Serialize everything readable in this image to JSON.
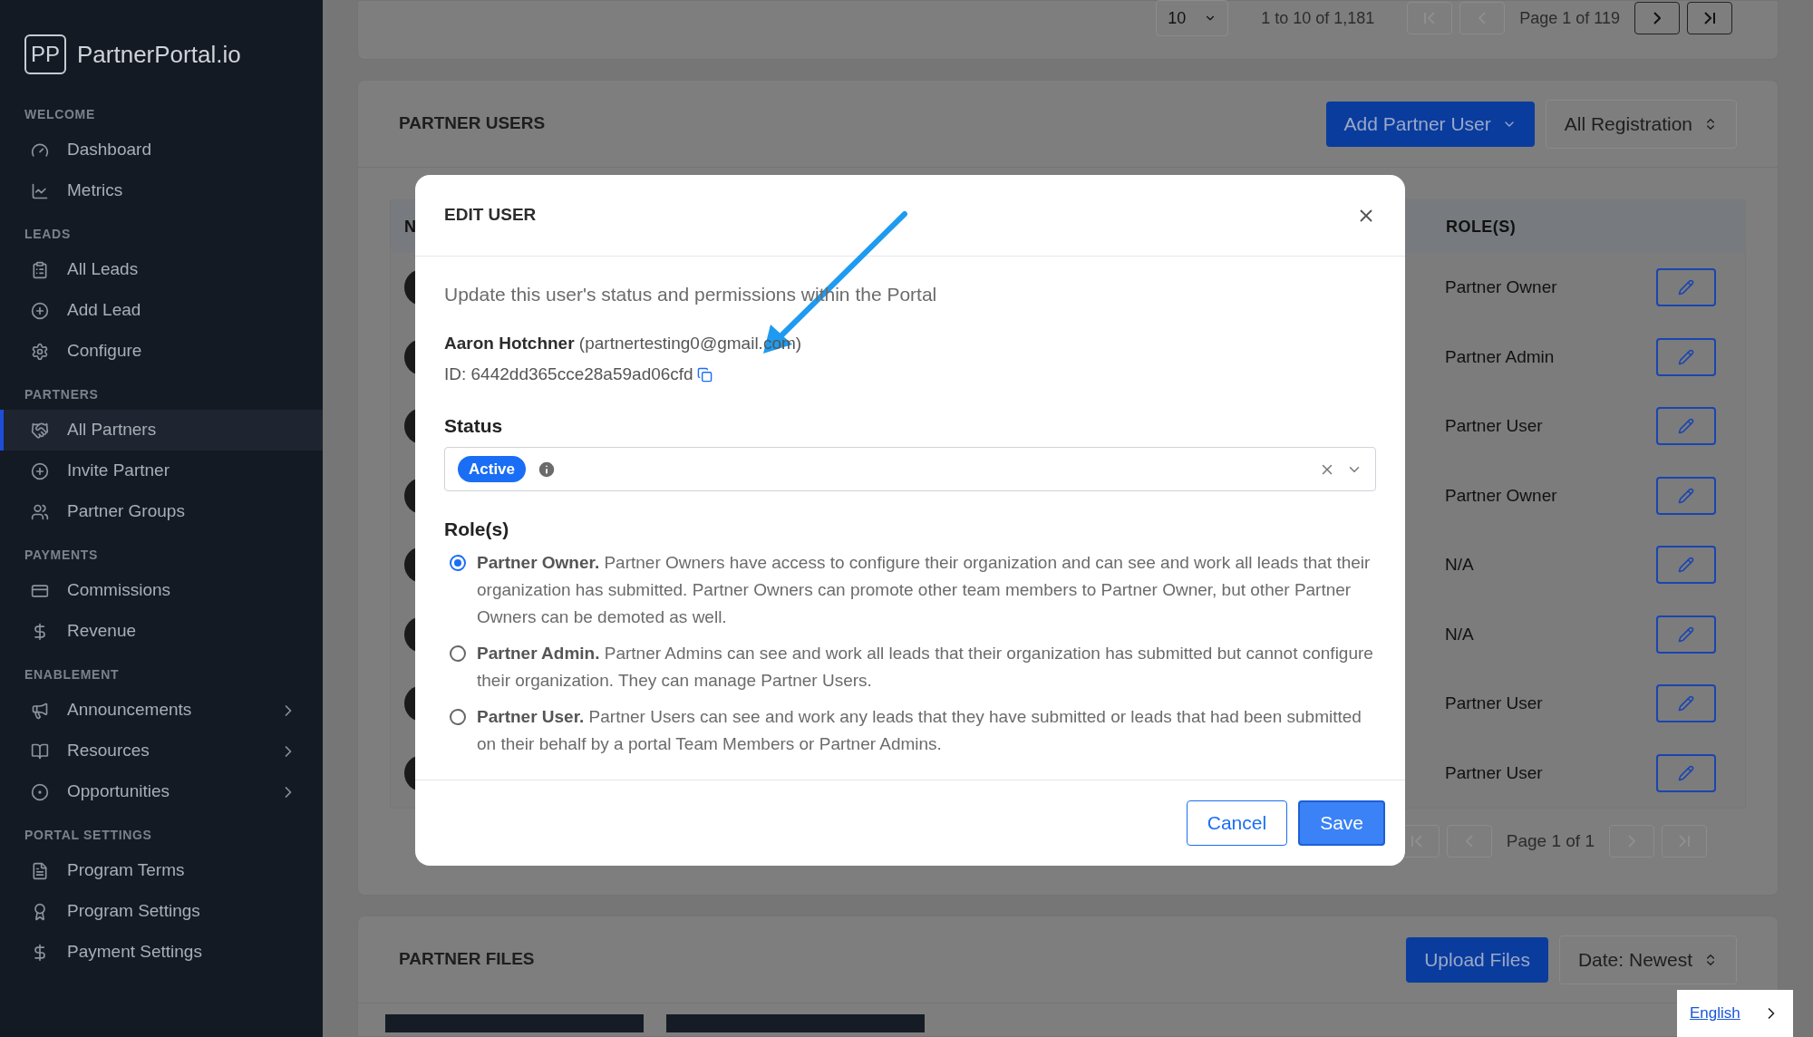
{
  "sidebar": {
    "brand": {
      "mark": "PP",
      "name": "PartnerPortal.io"
    },
    "sections": [
      {
        "title": "WELCOME",
        "items": [
          {
            "label": "Dashboard",
            "selected": false,
            "submenu": false
          },
          {
            "label": "Metrics",
            "selected": false,
            "submenu": false
          }
        ]
      },
      {
        "title": "LEADS",
        "items": [
          {
            "label": "All Leads",
            "selected": false,
            "submenu": false
          },
          {
            "label": "Add Lead",
            "selected": false,
            "submenu": false
          },
          {
            "label": "Configure",
            "selected": false,
            "submenu": false
          }
        ]
      },
      {
        "title": "PARTNERS",
        "items": [
          {
            "label": "All Partners",
            "selected": true,
            "submenu": false
          },
          {
            "label": "Invite Partner",
            "selected": false,
            "submenu": false
          },
          {
            "label": "Partner Groups",
            "selected": false,
            "submenu": false
          }
        ]
      },
      {
        "title": "PAYMENTS",
        "items": [
          {
            "label": "Commissions",
            "selected": false,
            "submenu": false
          },
          {
            "label": "Revenue",
            "selected": false,
            "submenu": false
          }
        ]
      },
      {
        "title": "ENABLEMENT",
        "items": [
          {
            "label": "Announcements",
            "selected": false,
            "submenu": true
          },
          {
            "label": "Resources",
            "selected": false,
            "submenu": true
          },
          {
            "label": "Opportunities",
            "selected": false,
            "submenu": true
          }
        ]
      },
      {
        "title": "PORTAL SETTINGS",
        "items": [
          {
            "label": "Program Terms",
            "selected": false,
            "submenu": false
          },
          {
            "label": "Program Settings",
            "selected": false,
            "submenu": false
          },
          {
            "label": "Payment Settings",
            "selected": false,
            "submenu": false
          }
        ]
      }
    ]
  },
  "top_pagination": {
    "page_size": "10",
    "range": "1 to 10 of 1,181",
    "page": "Page 1 of 119",
    "buttons": [
      {
        "kind": "first",
        "disabled": true
      },
      {
        "kind": "prev",
        "disabled": true
      },
      {
        "kind": "next",
        "disabled": false
      },
      {
        "kind": "last",
        "disabled": false
      }
    ]
  },
  "partner_users": {
    "title": "PARTNER USERS",
    "add_button": "Add Partner User",
    "filter": "All Registration",
    "table": {
      "columns": [
        "N",
        "ROLE(S)"
      ],
      "rows": [
        {
          "role": "Partner Owner"
        },
        {
          "role": "Partner Admin"
        },
        {
          "role": "Partner User"
        },
        {
          "role": "Partner Owner"
        },
        {
          "role": "N/A"
        },
        {
          "role": "N/A"
        },
        {
          "role": "Partner User"
        },
        {
          "role": "Partner User"
        }
      ]
    },
    "pagination": {
      "page": "Page 1 of 1",
      "buttons": [
        {
          "kind": "first",
          "disabled": true
        },
        {
          "kind": "prev",
          "disabled": true
        },
        {
          "kind": "next",
          "disabled": true
        },
        {
          "kind": "last",
          "disabled": true
        }
      ]
    }
  },
  "partner_files": {
    "title": "PARTNER FILES",
    "upload_button": "Upload Files",
    "sort": "Date: Newest"
  },
  "language": "English",
  "modal": {
    "title": "EDIT USER",
    "subtitle": "Update this user's status and permissions within the Portal",
    "user": "**Aaron Hotchner** (partnertesting0@gmail.com)",
    "id": "ID: 6442dd365cce28a59ad06cfd",
    "status": {
      "label": "Status",
      "value": "Active"
    },
    "roles": {
      "label": "Role(s)",
      "options": [
        {
          "text": "**Partner Owner.** Partner Owners have access to configure their organization and can see and work all leads that their organization has submitted. Partner Owners can promote other team members to Partner Owner, but other Partner Owners can be demoted as well.",
          "selected": true
        },
        {
          "text": "**Partner Admin.** Partner Admins can see and work all leads that their organization has submitted but cannot configure their organization. They can manage Partner Users.",
          "selected": false
        },
        {
          "text": "**Partner User.** Partner Users can see and work any leads that they have submitted or leads that had been submitted on their behalf by a portal Team Members or Partner Admins.",
          "selected": false
        }
      ]
    },
    "cancel": "Cancel",
    "save": "Save"
  }
}
